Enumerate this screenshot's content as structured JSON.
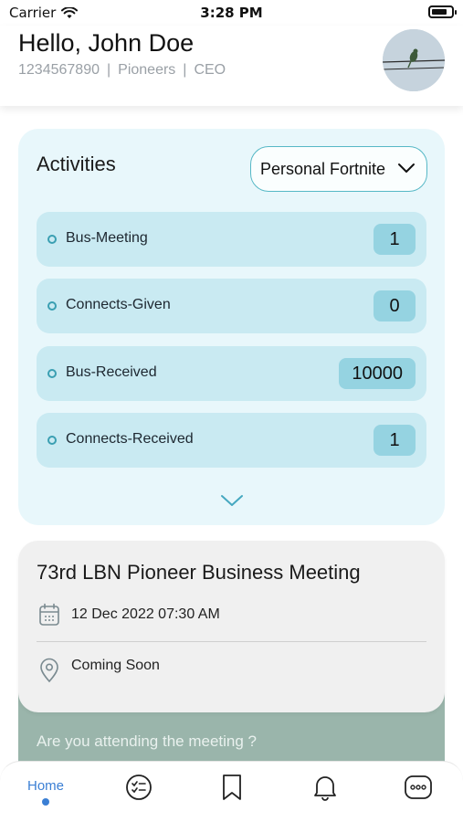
{
  "status_bar": {
    "carrier": "Carrier",
    "time": "3:28 PM",
    "battery_level": 0.8
  },
  "header": {
    "greeting": "Hello, John Doe",
    "phone": "1234567890",
    "group": "Pioneers",
    "role": "CEO",
    "separator": "|"
  },
  "activities": {
    "title": "Activities",
    "period_selected": "Personal Fortnite",
    "items": [
      {
        "label": "Bus-Meeting",
        "count": "1"
      },
      {
        "label": "Connects-Given",
        "count": "0"
      },
      {
        "label": "Bus-Received",
        "count": "10000"
      },
      {
        "label": "Connects-Received",
        "count": "1"
      }
    ]
  },
  "meeting": {
    "title": "73rd LBN Pioneer Business Meeting",
    "datetime": "12 Dec 2022 07:30 AM",
    "location": "Coming Soon",
    "attendance_question": "Are you attending the meeting ?"
  },
  "bottom_nav": {
    "active": "home",
    "home_label": "Home",
    "items": [
      "home",
      "tasks-icon",
      "bookmark-icon",
      "bell-icon",
      "more-icon"
    ]
  },
  "colors": {
    "accent": "#3b7fd4",
    "activity_bg": "#e8f7fb",
    "activity_row": "#c9eaf2",
    "count_badge": "#95d3e1",
    "meeting_footer": "#9ab5ab"
  }
}
